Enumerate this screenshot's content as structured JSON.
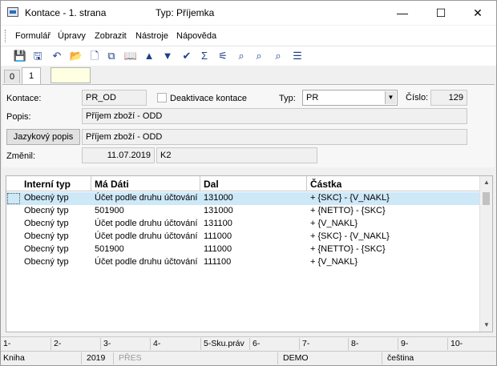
{
  "window": {
    "title": "Kontace - 1. strana",
    "type_caption": "Typ: Příjemka",
    "minimize": "—",
    "maximize": "☐",
    "close": "✕"
  },
  "menu": [
    "Formulář",
    "Úpravy",
    "Zobrazit",
    "Nástroje",
    "Nápověda"
  ],
  "toolbar_icons": [
    {
      "name": "save-icon",
      "glyph": "💾"
    },
    {
      "name": "save-as-icon",
      "glyph": "🖫"
    },
    {
      "name": "undo-icon",
      "glyph": "↶"
    },
    {
      "name": "open-folder-icon",
      "glyph": "📂"
    },
    {
      "name": "new-document-icon",
      "glyph": "🗋"
    },
    {
      "name": "copy-icon",
      "glyph": "⧉"
    },
    {
      "name": "book-icon",
      "glyph": "📖"
    },
    {
      "name": "arrow-up-icon",
      "glyph": "▲"
    },
    {
      "name": "arrow-down-icon",
      "glyph": "▼"
    },
    {
      "name": "check-arrow-icon",
      "glyph": "✔"
    },
    {
      "name": "sum-icon",
      "glyph": "Σ"
    },
    {
      "name": "filter-icon",
      "glyph": "⚟"
    },
    {
      "name": "binoculars-icon",
      "glyph": "⌕"
    },
    {
      "name": "binoculars-next-icon",
      "glyph": "⌕"
    },
    {
      "name": "binoculars-prev-icon",
      "glyph": "⌕"
    },
    {
      "name": "menu-lines-icon",
      "glyph": "☰"
    }
  ],
  "tabs": [
    "0",
    "1"
  ],
  "form": {
    "kontace_label": "Kontace:",
    "kontace_value": "PR_OD",
    "deactivate_label": "Deaktivace kontace",
    "typ_label": "Typ:",
    "typ_value": "PR",
    "cislo_label": "Číslo:",
    "cislo_value": "129",
    "popis_label": "Popis:",
    "popis_value": "Příjem zboží - ODD",
    "jazykovy_button": "Jazykový popis",
    "jazykovy_value": "Příjem zboží - ODD",
    "zmenil_label": "Změnil:",
    "zmenil_date": "11.07.2019",
    "zmenil_user": "K2"
  },
  "table": {
    "columns": [
      "Interní typ",
      "Má Dáti",
      "Dal",
      "Částka"
    ],
    "rows": [
      [
        "Obecný typ",
        "Účet podle druhu účtování",
        "131000",
        "+ {SKC} - {V_NAKL}"
      ],
      [
        "Obecný typ",
        "501900",
        "131000",
        "+ {NETTO} - {SKC}"
      ],
      [
        "Obecný typ",
        "Účet podle druhu účtování",
        "131100",
        "+ {V_NAKL}"
      ],
      [
        "Obecný typ",
        "Účet podle druhu účtování",
        "111000",
        "+ {SKC} - {V_NAKL}"
      ],
      [
        "Obecný typ",
        "501900",
        "111000",
        "+ {NETTO} - {SKC}"
      ],
      [
        "Obecný typ",
        "Účet podle druhu účtování",
        "111100",
        "+ {V_NAKL}"
      ]
    ]
  },
  "function_keys": [
    "1-",
    "2-",
    "3-",
    "4-",
    "5-Sku.práv",
    "6-",
    "7-",
    "8-",
    "9-",
    "10-"
  ],
  "status": {
    "module": "Kniha",
    "year": "2019",
    "mode": "PŘES",
    "database": "DEMO",
    "language": "čeština"
  }
}
